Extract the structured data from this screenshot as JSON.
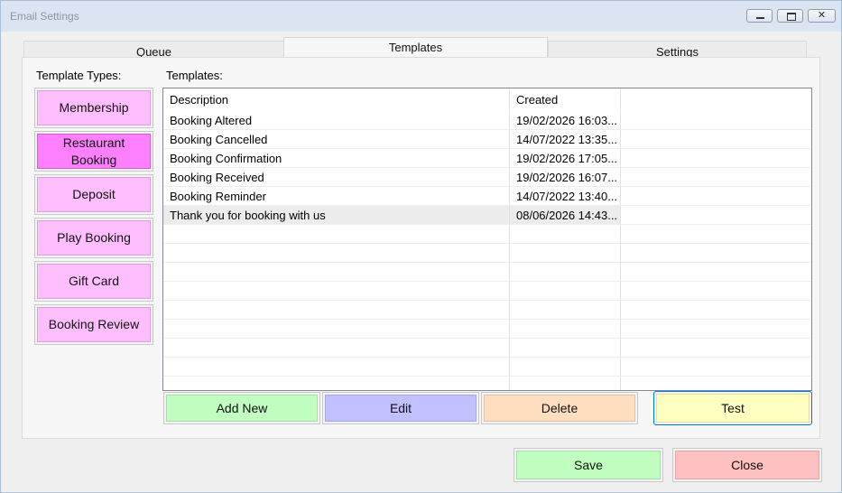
{
  "window": {
    "title": "Email Settings",
    "controls": [
      "minimize-icon",
      "restore-icon",
      "close-icon"
    ]
  },
  "tabs": [
    {
      "label": "Queue"
    },
    {
      "label": "Templates",
      "selected": true
    },
    {
      "label": "Settings"
    }
  ],
  "template_types": {
    "label": "Template Types:",
    "items": [
      {
        "label": "Membership"
      },
      {
        "label": "Restaurant Booking",
        "selected": true
      },
      {
        "label": "Deposit"
      },
      {
        "label": "Play Booking"
      },
      {
        "label": "Gift Card"
      },
      {
        "label": "Booking Review"
      }
    ]
  },
  "templates": {
    "label": "Templates:",
    "columns": [
      "Description",
      "Created"
    ],
    "rows": [
      {
        "description": "Booking Altered",
        "created": "19/02/2026 16:03..."
      },
      {
        "description": "Booking Cancelled",
        "created": "14/07/2022 13:35..."
      },
      {
        "description": "Booking Confirmation",
        "created": "19/02/2026 17:05..."
      },
      {
        "description": "Booking Received",
        "created": "19/02/2026 16:07..."
      },
      {
        "description": "Booking Reminder",
        "created": "14/07/2022 13:40..."
      },
      {
        "description": "Thank you for booking with us",
        "created": "08/06/2026 14:43...",
        "selected": true
      }
    ]
  },
  "actions": {
    "add_new": "Add New",
    "edit": "Edit",
    "delete": "Delete",
    "test": "Test"
  },
  "footer": {
    "save": "Save",
    "close": "Close"
  },
  "colors": {
    "type_button": "#ffbfff",
    "type_button_selected": "#ff80ff",
    "add": "#c0ffc0",
    "edit": "#c0c0ff",
    "delete": "#ffdfc0",
    "test": "#ffffc0",
    "save": "#c0ffc0",
    "close": "#ffc0c0",
    "focus_border": "#0078d7"
  }
}
